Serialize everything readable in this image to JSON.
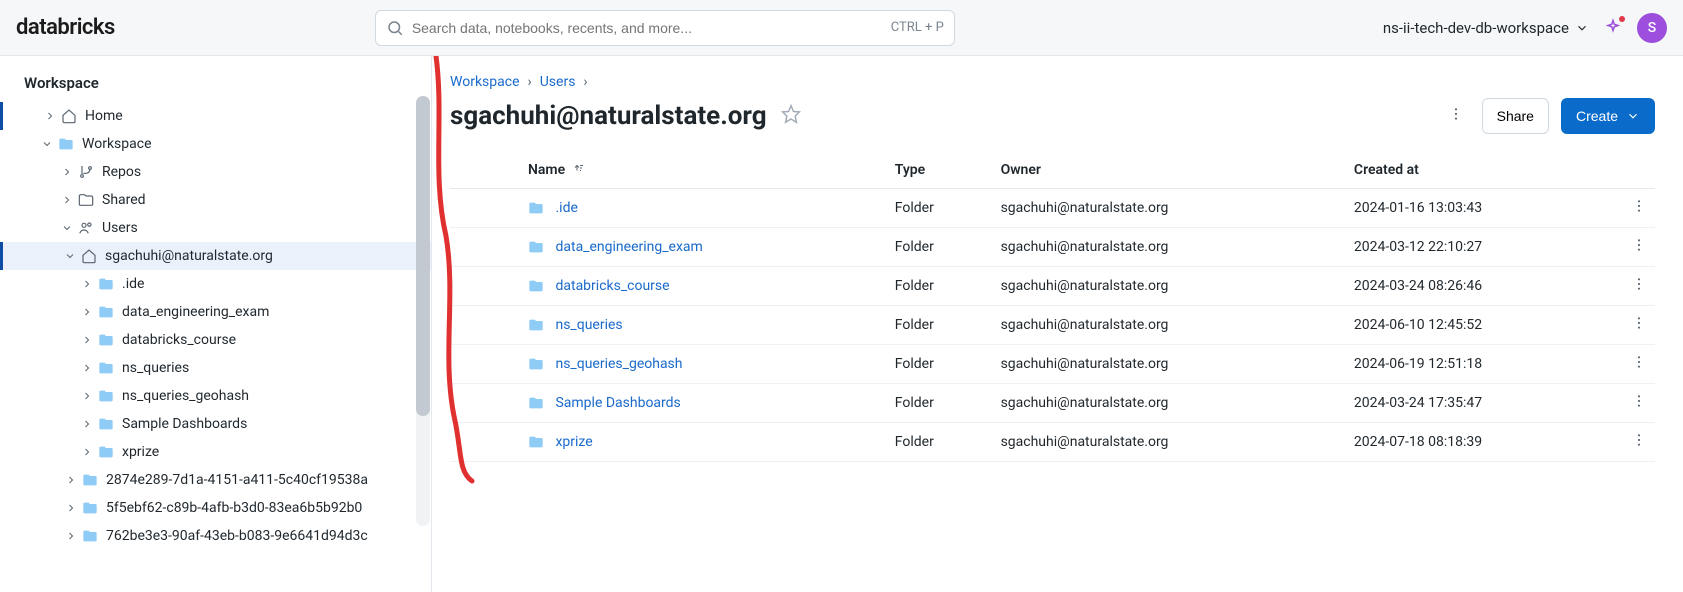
{
  "header": {
    "logo": "databricks",
    "search_placeholder": "Search data, notebooks, recents, and more...",
    "search_shortcut": "CTRL + P",
    "workspace_name": "ns-ii-tech-dev-db-workspace",
    "avatar_initial": "S"
  },
  "sidebar": {
    "title": "Workspace",
    "nodes": {
      "home": "Home",
      "workspace": "Workspace",
      "repos": "Repos",
      "shared": "Shared",
      "users": "Users",
      "user_email": "sgachuhi@naturalstate.org",
      "user_children": [
        ".ide",
        "data_engineering_exam",
        "databricks_course",
        "ns_queries",
        "ns_queries_geohash",
        "Sample Dashboards",
        "xprize"
      ],
      "siblings": [
        "2874e289-7d1a-4151-a411-5c40cf19538a",
        "5f5ebf62-c89b-4afb-b3d0-83ea6b5b92b0",
        "762be3e3-90af-43eb-b083-9e6641d94d3c"
      ]
    }
  },
  "breadcrumb": {
    "workspace": "Workspace",
    "users": "Users"
  },
  "page": {
    "title": "sgachuhi@naturalstate.org",
    "share_label": "Share",
    "create_label": "Create"
  },
  "table": {
    "columns": {
      "name": "Name",
      "type": "Type",
      "owner": "Owner",
      "created": "Created at"
    },
    "rows": [
      {
        "name": ".ide",
        "type": "Folder",
        "owner": "sgachuhi@naturalstate.org",
        "created": "2024-01-16 13:03:43"
      },
      {
        "name": "data_engineering_exam",
        "type": "Folder",
        "owner": "sgachuhi@naturalstate.org",
        "created": "2024-03-12 22:10:27"
      },
      {
        "name": "databricks_course",
        "type": "Folder",
        "owner": "sgachuhi@naturalstate.org",
        "created": "2024-03-24 08:26:46"
      },
      {
        "name": "ns_queries",
        "type": "Folder",
        "owner": "sgachuhi@naturalstate.org",
        "created": "2024-06-10 12:45:52"
      },
      {
        "name": "ns_queries_geohash",
        "type": "Folder",
        "owner": "sgachuhi@naturalstate.org",
        "created": "2024-06-19 12:51:18"
      },
      {
        "name": "Sample Dashboards",
        "type": "Folder",
        "owner": "sgachuhi@naturalstate.org",
        "created": "2024-03-24 17:35:47"
      },
      {
        "name": "xprize",
        "type": "Folder",
        "owner": "sgachuhi@naturalstate.org",
        "created": "2024-07-18 08:18:39"
      }
    ]
  }
}
